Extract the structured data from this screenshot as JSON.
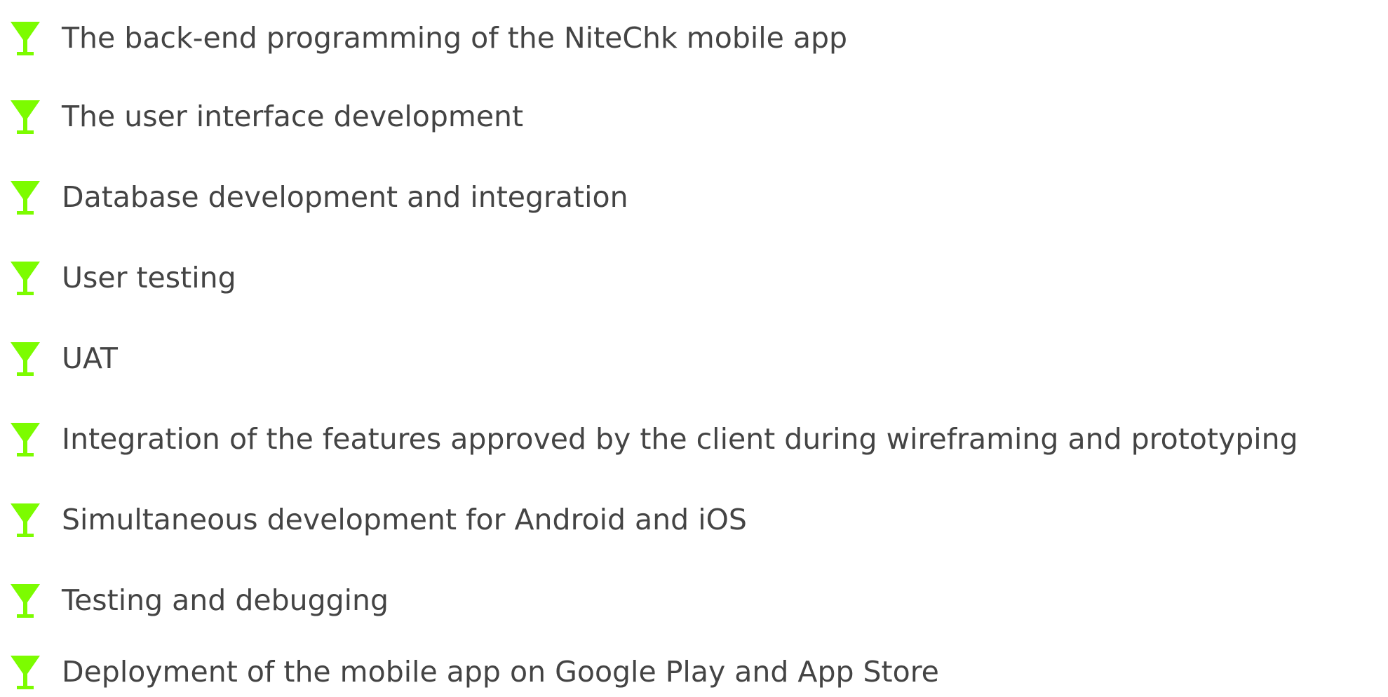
{
  "accent_color": "#7CFC00",
  "text_color": "#444444",
  "list": {
    "icon": "martini-glass-icon",
    "items": [
      {
        "label": "The back-end programming of the NiteChk mobile app"
      },
      {
        "label": "The user interface development"
      },
      {
        "label": "Database development and integration"
      },
      {
        "label": "User testing"
      },
      {
        "label": "UAT"
      },
      {
        "label": "Integration of the features approved by the client during wireframing and prototyping"
      },
      {
        "label": "Simultaneous development for Android and iOS"
      },
      {
        "label": "Testing and debugging"
      },
      {
        "label": "Deployment of the mobile app on Google Play and App Store"
      }
    ]
  }
}
